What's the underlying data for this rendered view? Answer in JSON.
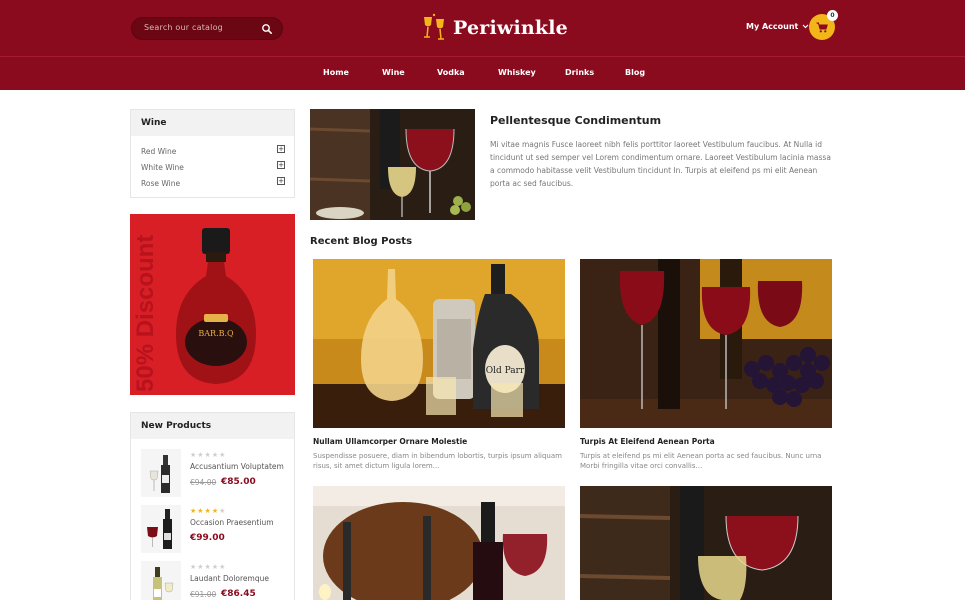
{
  "header": {
    "search_placeholder": "Search our catalog",
    "logo_text": "Periwinkle",
    "account_label": "My Account",
    "cart_count": "0",
    "nav": [
      "Home",
      "Wine",
      "Vodka",
      "Whiskey",
      "Drinks",
      "Blog"
    ]
  },
  "sidebar": {
    "category_title": "Wine",
    "categories": [
      "Red Wine",
      "White Wine",
      "Rose Wine"
    ],
    "banner_text": "50% Discount",
    "new_products_title": "New Products",
    "products": [
      {
        "name": "Accusantium Voluptatem",
        "rating": 0,
        "old_price": "€94.00",
        "price": "€85.00"
      },
      {
        "name": "Occasion Praesentium",
        "rating": 4,
        "old_price": "",
        "price": "€99.00"
      },
      {
        "name": "Laudant Doloremque",
        "rating": 0,
        "old_price": "€91.00",
        "price": "€86.45"
      }
    ]
  },
  "featured": {
    "title": "Pellentesque Condimentum",
    "text": "Mi vitae magnis Fusce laoreet nibh felis porttitor laoreet Vestibulum faucibus. At Nulla id tincidunt ut sed semper vel Lorem condimentum ornare. Laoreet Vestibulum lacinia massa a commodo habitasse velit Vestibulum tincidunt In. Turpis at eleifend ps mi elit Aenean porta ac sed faucibus."
  },
  "recent": {
    "title": "Recent Blog Posts",
    "posts": [
      {
        "title": "Nullam Ullamcorper Ornare Molestie",
        "text": "Suspendisse posuere, diam in bibendum lobortis, turpis ipsum aliquam risus, sit amet dictum ligula lorem..."
      },
      {
        "title": "Turpis At Eleifend Aenean Porta",
        "text": "Turpis at eleifend ps mi elit Aenean porta ac sed faucibus. Nunc urna Morbi fringilla vitae orci convallis..."
      }
    ]
  },
  "colors": {
    "primary": "#8a0a1e",
    "accent": "#f2b51a",
    "banner": "#d81f26"
  }
}
